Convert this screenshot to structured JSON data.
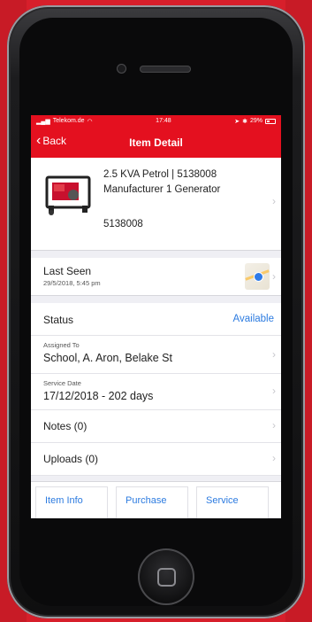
{
  "status_bar": {
    "carrier": "Telekom.de",
    "time": "17:48",
    "battery": "29%"
  },
  "nav": {
    "back_label": "Back",
    "title": "Item Detail"
  },
  "item": {
    "title": "2.5 KVA Petrol | 5138008 Manufacturer 1 Generator",
    "sku": "5138008"
  },
  "last_seen": {
    "label": "Last Seen",
    "date": "29/5/2018, 5:45 pm"
  },
  "status": {
    "label": "Status",
    "value": "Available"
  },
  "assigned_to": {
    "label": "Assigned To",
    "value": "School, A. Aron, Belake St"
  },
  "service_date": {
    "label": "Service Date",
    "value": "17/12/2018 - 202 days"
  },
  "notes": {
    "label": "Notes (0)"
  },
  "uploads": {
    "label": "Uploads (0)"
  },
  "tabs": [
    {
      "label": "Item Info"
    },
    {
      "label": "Purchase"
    },
    {
      "label": "Service"
    }
  ],
  "colors": {
    "brand_red": "#e4101f",
    "link_blue": "#2c7be0",
    "background_red": "#d71f2b"
  }
}
